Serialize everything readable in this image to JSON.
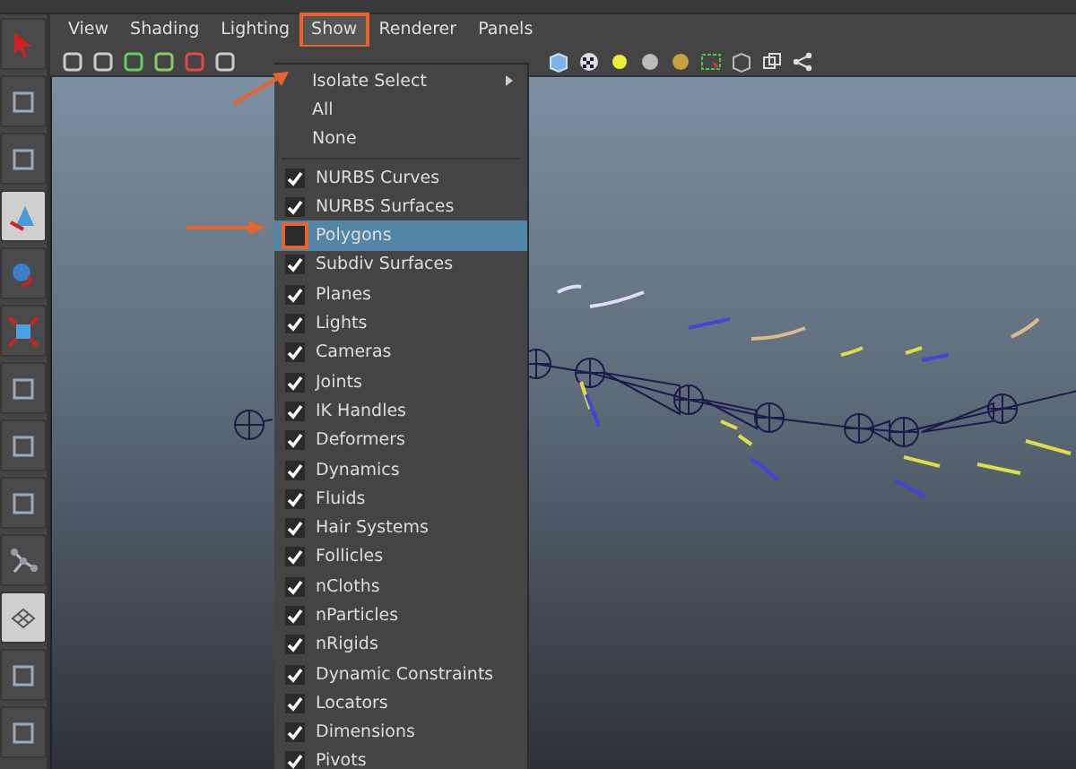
{
  "menu_bar": [
    {
      "label": "View",
      "selected": false
    },
    {
      "label": "Shading",
      "selected": false
    },
    {
      "label": "Lighting",
      "selected": false
    },
    {
      "label": "Show",
      "selected": true
    },
    {
      "label": "Renderer",
      "selected": false
    },
    {
      "label": "Panels",
      "selected": false
    }
  ],
  "show_menu": {
    "top_items": [
      {
        "label": "Isolate Select",
        "kind": "submenu"
      },
      {
        "label": "All",
        "kind": "plain"
      },
      {
        "label": "None",
        "kind": "plain"
      }
    ],
    "check_items": [
      {
        "label": "NURBS Curves",
        "checked": true,
        "selected": false
      },
      {
        "label": "NURBS Surfaces",
        "checked": true,
        "selected": false
      },
      {
        "label": "Polygons",
        "checked": false,
        "selected": true
      },
      {
        "label": "Subdiv Surfaces",
        "checked": true,
        "selected": false
      },
      {
        "label": "Planes",
        "checked": true,
        "selected": false
      },
      {
        "label": "Lights",
        "checked": true,
        "selected": false
      },
      {
        "label": "Cameras",
        "checked": true,
        "selected": false
      },
      {
        "label": "Joints",
        "checked": true,
        "selected": false
      },
      {
        "label": "IK Handles",
        "checked": true,
        "selected": false
      },
      {
        "label": "Deformers",
        "checked": true,
        "selected": false
      },
      {
        "label": "Dynamics",
        "checked": true,
        "selected": false
      },
      {
        "label": "Fluids",
        "checked": true,
        "selected": false
      },
      {
        "label": "Hair Systems",
        "checked": true,
        "selected": false
      },
      {
        "label": "Follicles",
        "checked": true,
        "selected": false
      },
      {
        "label": "nCloths",
        "checked": true,
        "selected": false
      },
      {
        "label": "nParticles",
        "checked": true,
        "selected": false
      },
      {
        "label": "nRigids",
        "checked": true,
        "selected": false
      },
      {
        "label": "Dynamic Constraints",
        "checked": true,
        "selected": false
      },
      {
        "label": "Locators",
        "checked": true,
        "selected": false
      },
      {
        "label": "Dimensions",
        "checked": true,
        "selected": false
      },
      {
        "label": "Pivots",
        "checked": true,
        "selected": false
      }
    ]
  }
}
